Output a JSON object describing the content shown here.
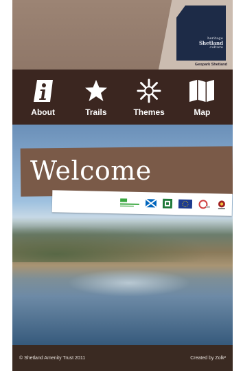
{
  "header": {
    "logo": {
      "line1": "heritage",
      "line2": "Shetland",
      "line3": "culture",
      "caption": "Geopark Shetland",
      "color": "#1d2b47"
    }
  },
  "nav": {
    "items": [
      {
        "label": "About",
        "icon": "info-icon"
      },
      {
        "label": "Trails",
        "icon": "star-icon"
      },
      {
        "label": "Themes",
        "icon": "sunburst-icon"
      },
      {
        "label": "Map",
        "icon": "map-icon"
      }
    ]
  },
  "main": {
    "welcome": "Welcome",
    "partners": [
      "partner-logo-green",
      "saltire-flag",
      "partner-logo-green-square",
      "eu-flag",
      "partner-logo-circle",
      "geopark-logo"
    ]
  },
  "footer": {
    "left": "© Shetland Amenity Trust 2011",
    "right": "Created by Zolk²"
  },
  "colors": {
    "header_brown": "#9c8474",
    "nav_dark_brown": "#3b2620",
    "banner_brown": "#7a5a48"
  }
}
